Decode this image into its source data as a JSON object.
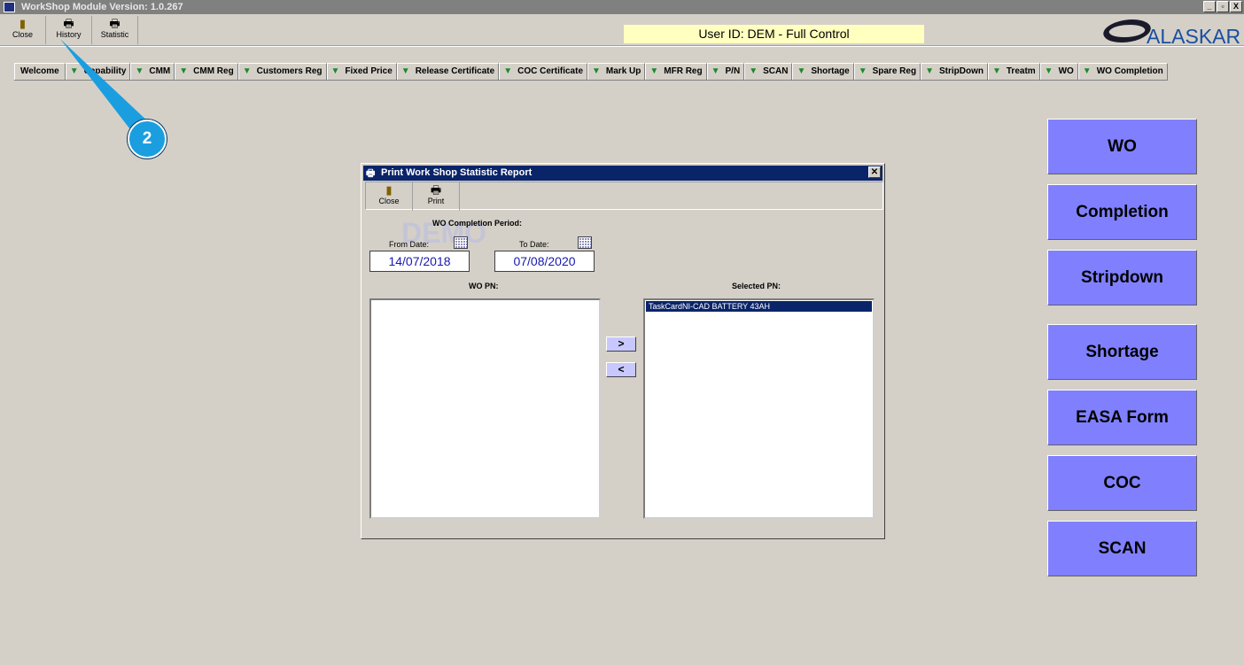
{
  "window": {
    "title": "WorkShop Module  Version: 1.0.267",
    "min": "_",
    "max": "▫",
    "close": "X"
  },
  "toolbar": [
    {
      "label": "Close",
      "icon": "door-exit-icon"
    },
    {
      "label": "History",
      "icon": "printer-icon"
    },
    {
      "label": "Statistic",
      "icon": "printer-icon"
    }
  ],
  "user_info": "User ID: DEM - Full Control",
  "logo": "ALASKAR",
  "tabs": [
    "Welcome",
    "Capability",
    "CMM",
    "CMM Reg",
    "Customers Reg",
    "Fixed Price",
    "Release Certificate",
    "COC Certificate",
    "Mark Up",
    "MFR Reg",
    "P/N",
    "SCAN",
    "Shortage",
    "Spare Reg",
    "StripDown",
    "Treatm",
    "WO",
    "WO Completion"
  ],
  "side_buttons": [
    "WO",
    "Completion",
    "Stripdown",
    "Shortage",
    "EASA Form",
    "COC",
    "SCAN"
  ],
  "colors": {
    "side_button": "#8080ff",
    "title_active": "#0a246a",
    "user_box": "#ffffc0",
    "date_text": "#1818b0"
  },
  "dialog": {
    "title": "Print Work Shop Statistic Report",
    "close": "✕",
    "toolbar": [
      {
        "label": "Close",
        "icon": "door-exit-icon"
      },
      {
        "label": "Print",
        "icon": "printer-icon"
      }
    ],
    "watermark": "DEMO",
    "period_label": "WO Completion Period:",
    "from_label": "From Date:",
    "from_value": "14/07/2018",
    "to_label": "To Date:",
    "to_value": "07/08/2020",
    "wo_pn_label": "WO PN:",
    "selected_pn_label": "Selected PN:",
    "wo_pn_items": [],
    "selected_pn_items": [
      "TaskCardNI-CAD BATTERY 43AH"
    ],
    "add_label": ">",
    "remove_label": "<"
  },
  "callout": {
    "number": "2"
  }
}
